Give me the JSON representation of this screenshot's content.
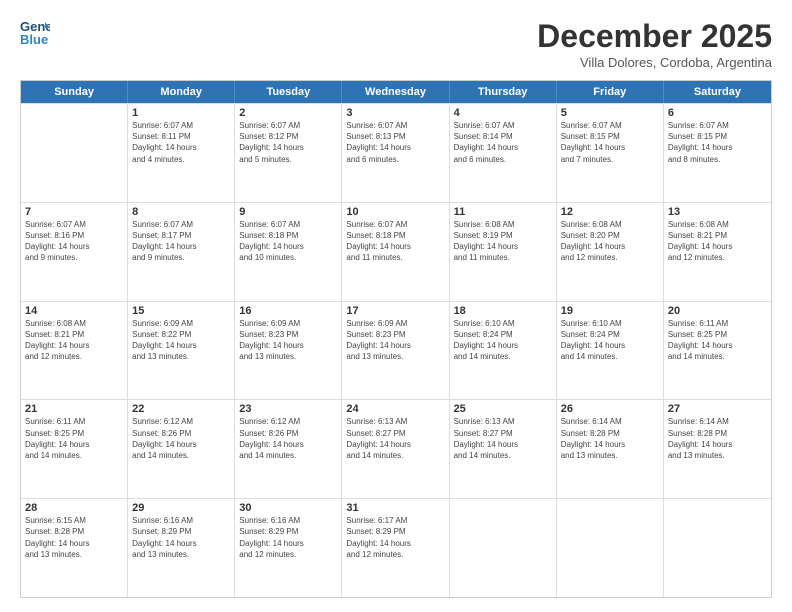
{
  "logo": {
    "line1": "General",
    "line2": "Blue"
  },
  "title": "December 2025",
  "subtitle": "Villa Dolores, Cordoba, Argentina",
  "days": [
    "Sunday",
    "Monday",
    "Tuesday",
    "Wednesday",
    "Thursday",
    "Friday",
    "Saturday"
  ],
  "weeks": [
    [
      {
        "day": "",
        "info": ""
      },
      {
        "day": "1",
        "info": "Sunrise: 6:07 AM\nSunset: 8:11 PM\nDaylight: 14 hours\nand 4 minutes."
      },
      {
        "day": "2",
        "info": "Sunrise: 6:07 AM\nSunset: 8:12 PM\nDaylight: 14 hours\nand 5 minutes."
      },
      {
        "day": "3",
        "info": "Sunrise: 6:07 AM\nSunset: 8:13 PM\nDaylight: 14 hours\nand 6 minutes."
      },
      {
        "day": "4",
        "info": "Sunrise: 6:07 AM\nSunset: 8:14 PM\nDaylight: 14 hours\nand 6 minutes."
      },
      {
        "day": "5",
        "info": "Sunrise: 6:07 AM\nSunset: 8:15 PM\nDaylight: 14 hours\nand 7 minutes."
      },
      {
        "day": "6",
        "info": "Sunrise: 6:07 AM\nSunset: 8:15 PM\nDaylight: 14 hours\nand 8 minutes."
      }
    ],
    [
      {
        "day": "7",
        "info": "Sunrise: 6:07 AM\nSunset: 8:16 PM\nDaylight: 14 hours\nand 9 minutes."
      },
      {
        "day": "8",
        "info": "Sunrise: 6:07 AM\nSunset: 8:17 PM\nDaylight: 14 hours\nand 9 minutes."
      },
      {
        "day": "9",
        "info": "Sunrise: 6:07 AM\nSunset: 8:18 PM\nDaylight: 14 hours\nand 10 minutes."
      },
      {
        "day": "10",
        "info": "Sunrise: 6:07 AM\nSunset: 8:18 PM\nDaylight: 14 hours\nand 11 minutes."
      },
      {
        "day": "11",
        "info": "Sunrise: 6:08 AM\nSunset: 8:19 PM\nDaylight: 14 hours\nand 11 minutes."
      },
      {
        "day": "12",
        "info": "Sunrise: 6:08 AM\nSunset: 8:20 PM\nDaylight: 14 hours\nand 12 minutes."
      },
      {
        "day": "13",
        "info": "Sunrise: 6:08 AM\nSunset: 8:21 PM\nDaylight: 14 hours\nand 12 minutes."
      }
    ],
    [
      {
        "day": "14",
        "info": "Sunrise: 6:08 AM\nSunset: 8:21 PM\nDaylight: 14 hours\nand 12 minutes."
      },
      {
        "day": "15",
        "info": "Sunrise: 6:09 AM\nSunset: 8:22 PM\nDaylight: 14 hours\nand 13 minutes."
      },
      {
        "day": "16",
        "info": "Sunrise: 6:09 AM\nSunset: 8:23 PM\nDaylight: 14 hours\nand 13 minutes."
      },
      {
        "day": "17",
        "info": "Sunrise: 6:09 AM\nSunset: 8:23 PM\nDaylight: 14 hours\nand 13 minutes."
      },
      {
        "day": "18",
        "info": "Sunrise: 6:10 AM\nSunset: 8:24 PM\nDaylight: 14 hours\nand 14 minutes."
      },
      {
        "day": "19",
        "info": "Sunrise: 6:10 AM\nSunset: 8:24 PM\nDaylight: 14 hours\nand 14 minutes."
      },
      {
        "day": "20",
        "info": "Sunrise: 6:11 AM\nSunset: 8:25 PM\nDaylight: 14 hours\nand 14 minutes."
      }
    ],
    [
      {
        "day": "21",
        "info": "Sunrise: 6:11 AM\nSunset: 8:25 PM\nDaylight: 14 hours\nand 14 minutes."
      },
      {
        "day": "22",
        "info": "Sunrise: 6:12 AM\nSunset: 8:26 PM\nDaylight: 14 hours\nand 14 minutes."
      },
      {
        "day": "23",
        "info": "Sunrise: 6:12 AM\nSunset: 8:26 PM\nDaylight: 14 hours\nand 14 minutes."
      },
      {
        "day": "24",
        "info": "Sunrise: 6:13 AM\nSunset: 8:27 PM\nDaylight: 14 hours\nand 14 minutes."
      },
      {
        "day": "25",
        "info": "Sunrise: 6:13 AM\nSunset: 8:27 PM\nDaylight: 14 hours\nand 14 minutes."
      },
      {
        "day": "26",
        "info": "Sunrise: 6:14 AM\nSunset: 8:28 PM\nDaylight: 14 hours\nand 13 minutes."
      },
      {
        "day": "27",
        "info": "Sunrise: 6:14 AM\nSunset: 8:28 PM\nDaylight: 14 hours\nand 13 minutes."
      }
    ],
    [
      {
        "day": "28",
        "info": "Sunrise: 6:15 AM\nSunset: 8:28 PM\nDaylight: 14 hours\nand 13 minutes."
      },
      {
        "day": "29",
        "info": "Sunrise: 6:16 AM\nSunset: 8:29 PM\nDaylight: 14 hours\nand 13 minutes."
      },
      {
        "day": "30",
        "info": "Sunrise: 6:16 AM\nSunset: 8:29 PM\nDaylight: 14 hours\nand 12 minutes."
      },
      {
        "day": "31",
        "info": "Sunrise: 6:17 AM\nSunset: 8:29 PM\nDaylight: 14 hours\nand 12 minutes."
      },
      {
        "day": "",
        "info": ""
      },
      {
        "day": "",
        "info": ""
      },
      {
        "day": "",
        "info": ""
      }
    ]
  ]
}
